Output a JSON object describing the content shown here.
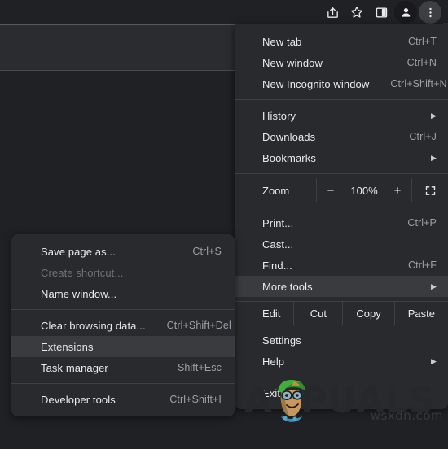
{
  "toolbar": {
    "icons": [
      {
        "name": "share-icon",
        "title": "Share this page"
      },
      {
        "name": "bookmark-star-icon",
        "title": "Bookmark this tab"
      },
      {
        "name": "side-panel-icon",
        "title": "Show side panel"
      },
      {
        "name": "profile-avatar-icon",
        "title": "Profile"
      },
      {
        "name": "three-dot-menu-icon",
        "title": "Customize and control Google Chrome"
      }
    ]
  },
  "main_menu": {
    "groups": [
      {
        "items": [
          {
            "label": "New tab",
            "accel": "Ctrl+T",
            "arrow": false,
            "disabled": false,
            "highlight": false
          },
          {
            "label": "New window",
            "accel": "Ctrl+N",
            "arrow": false,
            "disabled": false,
            "highlight": false
          },
          {
            "label": "New Incognito window",
            "accel": "Ctrl+Shift+N",
            "arrow": false,
            "disabled": false,
            "highlight": false
          }
        ]
      },
      {
        "items": [
          {
            "label": "History",
            "accel": "",
            "arrow": true,
            "disabled": false,
            "highlight": false
          },
          {
            "label": "Downloads",
            "accel": "Ctrl+J",
            "arrow": false,
            "disabled": false,
            "highlight": false
          },
          {
            "label": "Bookmarks",
            "accel": "",
            "arrow": true,
            "disabled": false,
            "highlight": false
          }
        ]
      },
      {
        "items": [
          {
            "label": "Print...",
            "accel": "Ctrl+P",
            "arrow": false,
            "disabled": false,
            "highlight": false
          },
          {
            "label": "Cast...",
            "accel": "",
            "arrow": false,
            "disabled": false,
            "highlight": false
          },
          {
            "label": "Find...",
            "accel": "Ctrl+F",
            "arrow": false,
            "disabled": false,
            "highlight": false
          },
          {
            "label": "More tools",
            "accel": "",
            "arrow": true,
            "disabled": false,
            "highlight": true
          }
        ]
      },
      {
        "items": [
          {
            "label": "Settings",
            "accel": "",
            "arrow": false,
            "disabled": false,
            "highlight": false
          },
          {
            "label": "Help",
            "accel": "",
            "arrow": true,
            "disabled": false,
            "highlight": false
          }
        ]
      },
      {
        "items": [
          {
            "label": "Exit",
            "accel": "",
            "arrow": false,
            "disabled": false,
            "highlight": false
          }
        ]
      }
    ],
    "zoom_row": {
      "label": "Zoom",
      "minus": "−",
      "value": "100%",
      "plus": "+",
      "fullscreen_icon": "fullscreen-icon"
    },
    "edit_row": {
      "label": "Edit",
      "cells": [
        "Cut",
        "Copy",
        "Paste"
      ]
    }
  },
  "submenu": {
    "title": "More tools",
    "groups": [
      {
        "items": [
          {
            "label": "Save page as...",
            "accel": "Ctrl+S",
            "disabled": false,
            "highlight": false
          },
          {
            "label": "Create shortcut...",
            "accel": "",
            "disabled": true,
            "highlight": false
          },
          {
            "label": "Name window...",
            "accel": "",
            "disabled": false,
            "highlight": false
          }
        ]
      },
      {
        "items": [
          {
            "label": "Clear browsing data...",
            "accel": "Ctrl+Shift+Del",
            "disabled": false,
            "highlight": false
          },
          {
            "label": "Extensions",
            "accel": "",
            "disabled": false,
            "highlight": true
          },
          {
            "label": "Task manager",
            "accel": "Shift+Esc",
            "disabled": false,
            "highlight": false
          }
        ]
      },
      {
        "items": [
          {
            "label": "Developer tools",
            "accel": "Ctrl+Shift+I",
            "disabled": false,
            "highlight": false
          }
        ]
      }
    ]
  },
  "watermark": {
    "brand_prefix": "A",
    "brand_suffix": "PUALS",
    "mascot": "appuals-mascot-icon",
    "site": "wsxdn.com"
  },
  "colors": {
    "menu_background": "#292a2d",
    "menu_text": "#e8eaed",
    "accel_text": "#9aa0a6",
    "disabled_text": "#6e7276",
    "highlight": "#3a3b3e",
    "separator": "#3f4043",
    "page_background": "#202124",
    "toolbar_band": "#2b2c2f",
    "watermark_text": "#27282b",
    "mascot_cap": "#2e8b2e"
  }
}
